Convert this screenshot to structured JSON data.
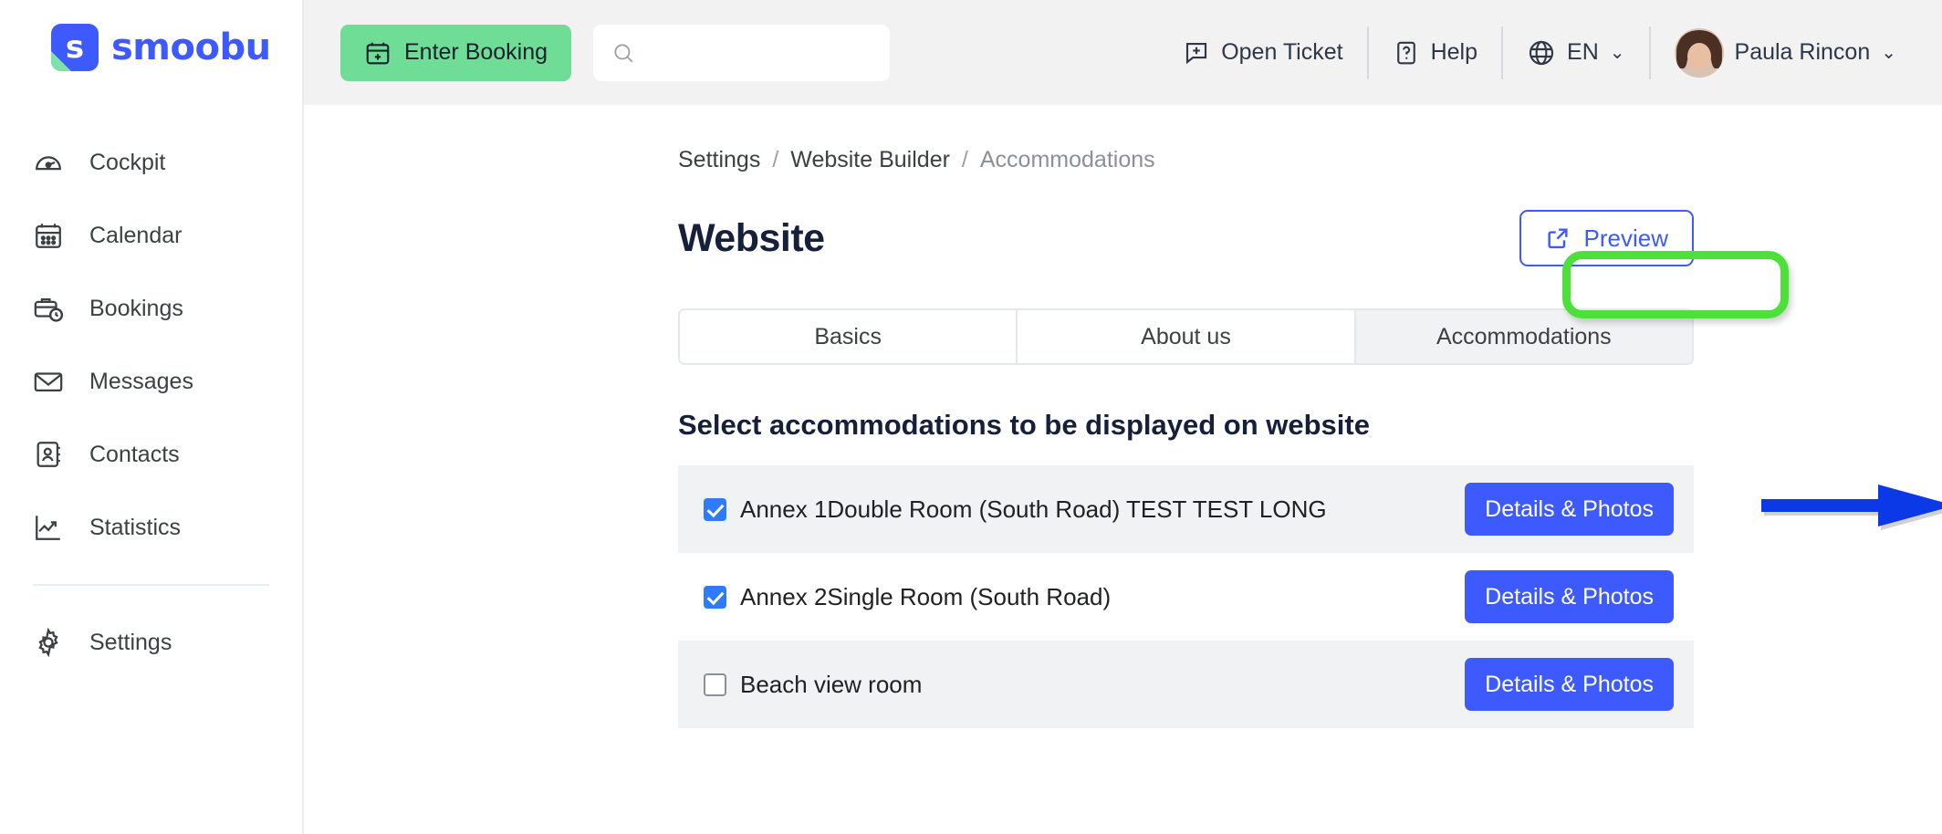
{
  "brand": {
    "name": "smoobu",
    "logo_letter": "s",
    "color": "#3d5afe",
    "accent": "#7ee2a8"
  },
  "sidebar": {
    "items": [
      {
        "label": "Cockpit",
        "icon": "cockpit-icon"
      },
      {
        "label": "Calendar",
        "icon": "calendar-icon"
      },
      {
        "label": "Bookings",
        "icon": "bookings-icon"
      },
      {
        "label": "Messages",
        "icon": "envelope-icon"
      },
      {
        "label": "Contacts",
        "icon": "contacts-icon"
      },
      {
        "label": "Statistics",
        "icon": "chart-icon"
      },
      {
        "label": "Settings",
        "icon": "gear-icon"
      }
    ]
  },
  "topbar": {
    "enter_booking_label": "Enter Booking",
    "search_placeholder": "",
    "search_value": "",
    "open_ticket_label": "Open Ticket",
    "help_label": "Help",
    "language_label": "EN",
    "user_name": "Paula Rincon"
  },
  "breadcrumb": {
    "items": [
      "Settings",
      "Website Builder",
      "Accommodations"
    ],
    "separator": "/"
  },
  "page": {
    "title": "Website",
    "preview_label": "Preview",
    "section_heading": "Select accommodations to be displayed on website"
  },
  "tabs": [
    {
      "label": "Basics",
      "active": false
    },
    {
      "label": "About us",
      "active": false
    },
    {
      "label": "Accommodations",
      "active": true
    }
  ],
  "accommodations": [
    {
      "name": "Annex 1Double Room (South Road) TEST TEST LONG",
      "checked": true,
      "button_label": "Details & Photos"
    },
    {
      "name": "Annex 2Single Room (South Road)",
      "checked": true,
      "button_label": "Details & Photos"
    },
    {
      "name": "Beach view room",
      "checked": false,
      "button_label": "Details & Photos"
    }
  ],
  "annotations": {
    "highlight_target": "Accommodations",
    "highlight_color": "#4ee03a",
    "arrow_target": "Details & Photos",
    "arrow_color": "#0b39e8"
  }
}
